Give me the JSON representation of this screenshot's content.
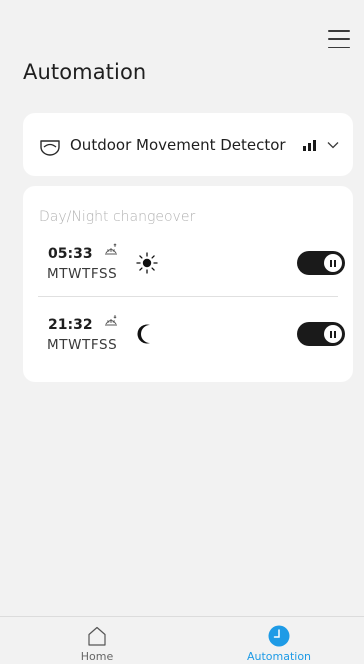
{
  "header": {
    "title": "Automation",
    "menu_icon": "hamburger-menu-icon"
  },
  "device": {
    "name": "Outdoor Movement Detector",
    "icon": "motion-detector-icon",
    "signal_icon": "signal-strength-icon",
    "expand_icon": "chevron-down-icon"
  },
  "schedule": {
    "section_label": "Day/Night changeover",
    "items": [
      {
        "time": "05:33",
        "days": "MTWTFSS",
        "event": "sunrise",
        "mode": "day",
        "enabled": true
      },
      {
        "time": "21:32",
        "days": "MTWTFSS",
        "event": "sunset",
        "mode": "night",
        "enabled": true
      }
    ]
  },
  "bottom_nav": {
    "items": [
      {
        "label": "Home",
        "icon": "home-icon",
        "active": false
      },
      {
        "label": "Automation",
        "icon": "clock-icon",
        "active": true
      }
    ],
    "active_color": "#1e9be6"
  },
  "colors": {
    "background": "#f2f2f2",
    "card": "#ffffff",
    "toggle_on": "#1a1a1a",
    "accent": "#1e9be6"
  }
}
